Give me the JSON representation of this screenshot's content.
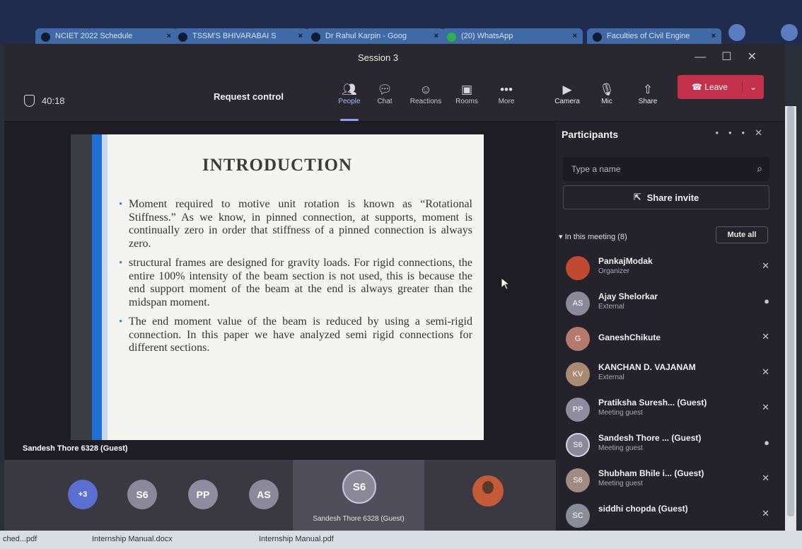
{
  "browser": {
    "tabs": [
      {
        "label": "NCIET 2022 Schedule"
      },
      {
        "label": "TSSM'S BHIVARABAI S"
      },
      {
        "label": "Dr Rahul Karpin - Goog"
      },
      {
        "label": "(20) WhatsApp"
      },
      {
        "label": "Faculties of Civil Engine"
      }
    ]
  },
  "window": {
    "title": "Session 3",
    "controls": [
      "—",
      "☐",
      "✕"
    ]
  },
  "toolbar": {
    "timer": "40:18",
    "request_control": "Request control",
    "items": [
      {
        "label": "People",
        "icon": "people-icon"
      },
      {
        "label": "Chat",
        "icon": "chat-icon"
      },
      {
        "label": "Reactions",
        "icon": "reactions-icon"
      },
      {
        "label": "Rooms",
        "icon": "rooms-icon"
      },
      {
        "label": "More",
        "icon": "more-icon"
      },
      {
        "label": "Camera",
        "icon": "camera-off-icon"
      },
      {
        "label": "Mic",
        "icon": "mic-off-icon"
      },
      {
        "label": "Share",
        "icon": "share-icon"
      }
    ],
    "leave_label": "Leave"
  },
  "slide": {
    "title": "INTRODUCTION",
    "bullets": [
      "Moment required to motive unit rotation is known as “Rotational Stiffness.” As we know, in pinned connection, at supports, moment is continually zero in order that stiffness of a pinned connection is always zero.",
      "structural frames are designed for gravity loads. For rigid connections, the entire 100% intensity of the beam section is not used, this is because the end support moment of the beam at the end is always greater than the midspan moment.",
      "The end moment value of the beam is reduced by using a semi-rigid connection. In this paper we have analyzed semi rigid connections for different sections."
    ]
  },
  "stage": {
    "speaker_label": "Sandesh Thore 6328 (Guest)"
  },
  "gallery": {
    "overflow": "+3",
    "avatars": [
      "S6",
      "PP",
      "AS"
    ],
    "active_initials": "S6",
    "active_name": "Sandesh Thore 6328 (Guest)"
  },
  "participants": {
    "title": "Participants",
    "search_placeholder": "Type a name",
    "share_invite": "Share invite",
    "section_label": "In this meeting (8)",
    "mute_all": "Mute all",
    "list": [
      {
        "initials": "",
        "name": "PankajModak",
        "role": "Organizer",
        "mic": "muted",
        "color": "#c0492f"
      },
      {
        "initials": "AS",
        "name": "Ajay Shelorkar",
        "role": "External",
        "mic": "on",
        "color": "#8c8a9a"
      },
      {
        "initials": "G",
        "name": "GaneshChikute",
        "role": "",
        "mic": "muted",
        "color": "#b57a6b"
      },
      {
        "initials": "KV",
        "name": "KANCHAN D. VAJANAM",
        "role": "External",
        "mic": "muted",
        "color": "#a78c73"
      },
      {
        "initials": "PP",
        "name": "Pratiksha Suresh... (Guest)",
        "role": "Meeting guest",
        "mic": "muted",
        "color": "#8f8ca0"
      },
      {
        "initials": "S6",
        "name": "Sandesh Thore ... (Guest)",
        "role": "Meeting guest",
        "mic": "on",
        "color": "#8a8899"
      },
      {
        "initials": "S6",
        "name": "Shubham Bhile i... (Guest)",
        "role": "Meeting guest",
        "mic": "muted",
        "color": "#a08b80"
      },
      {
        "initials": "SC",
        "name": "siddhi chopda (Guest)",
        "role": "",
        "mic": "muted",
        "color": "#8a8d98"
      }
    ]
  },
  "downloads": [
    {
      "label": "ched...pdf"
    },
    {
      "label": "Internship Manual.docx"
    },
    {
      "label": "Internship Manual.pdf"
    }
  ]
}
